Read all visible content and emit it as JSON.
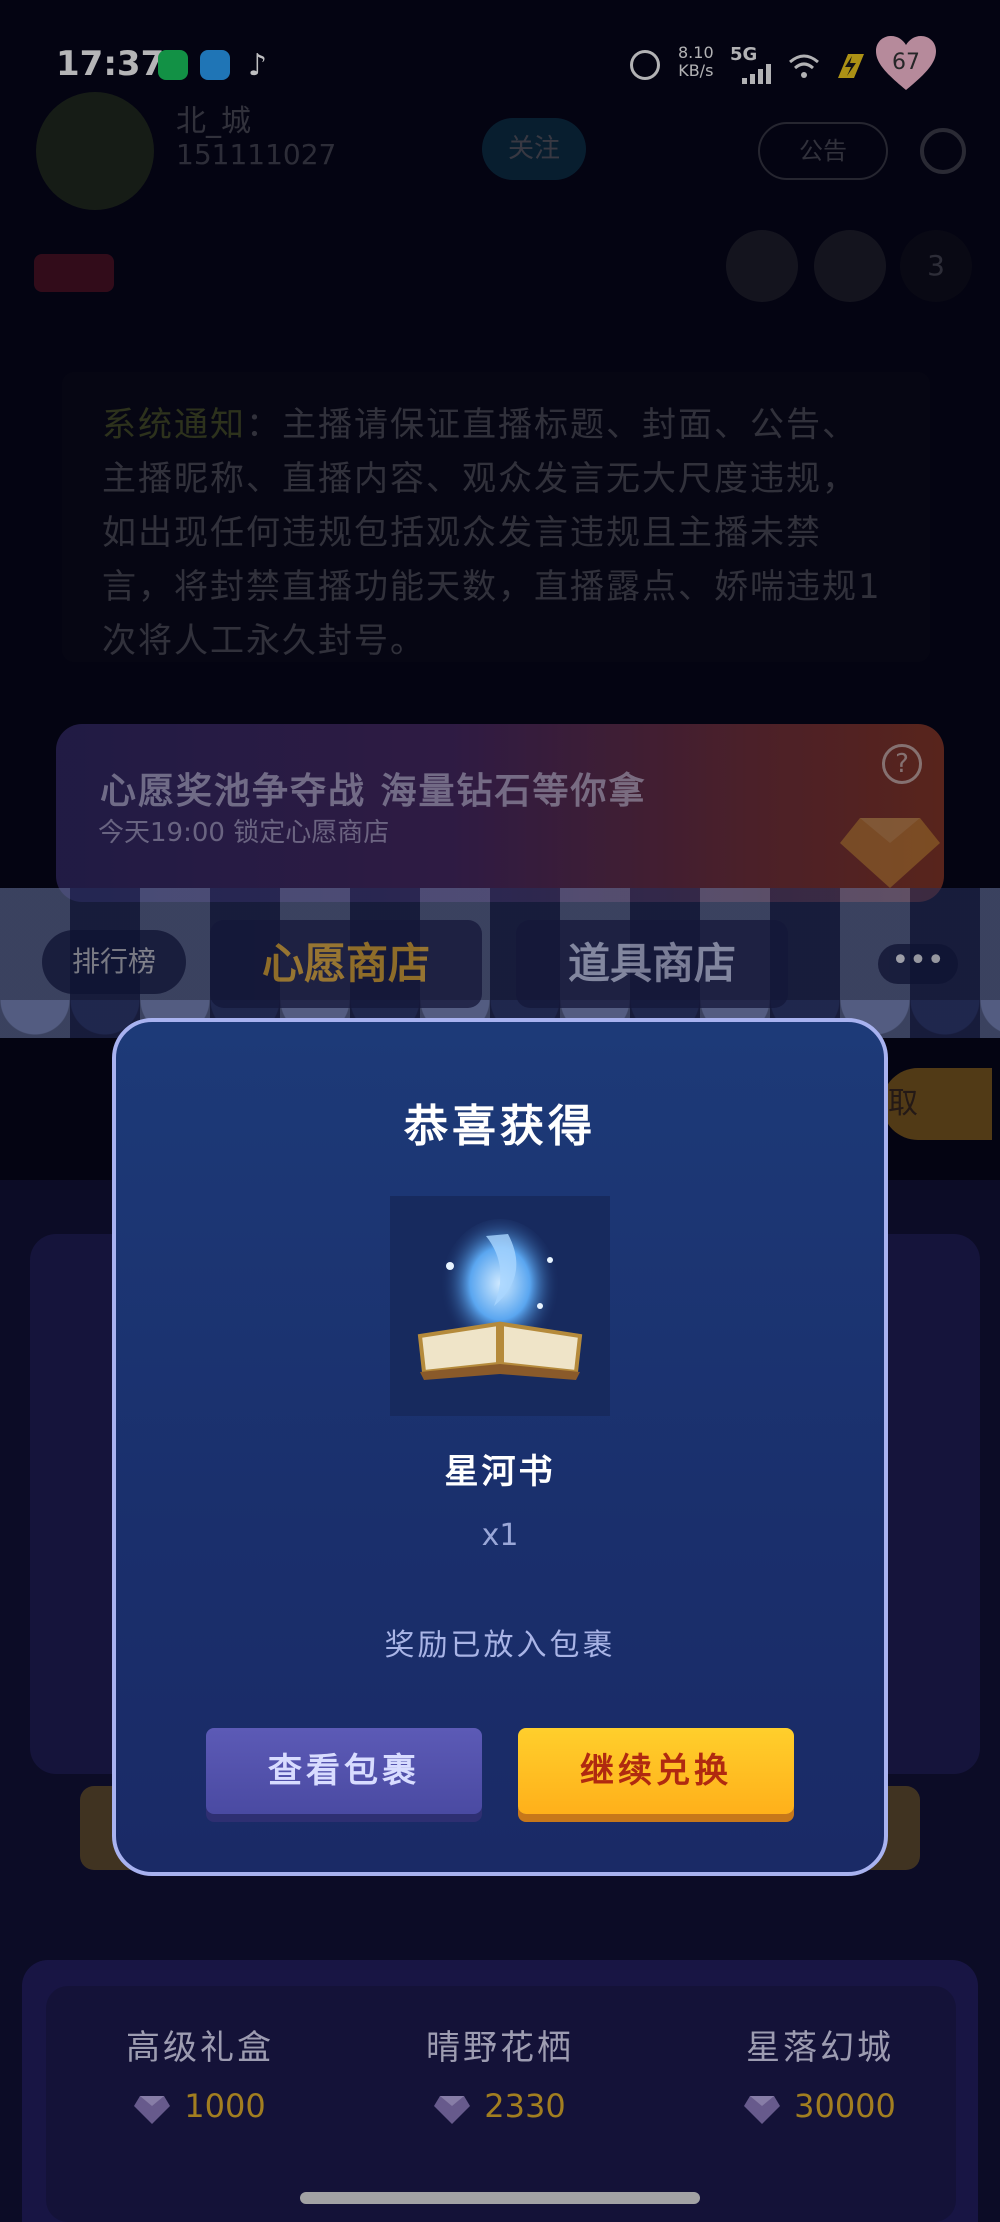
{
  "status_bar": {
    "time": "17:37",
    "net_speed": "8.10",
    "net_unit": "KB/s",
    "network": "5G",
    "battery": "67"
  },
  "background": {
    "streamer_name": "北_城",
    "streamer_id": "151111027",
    "follow_label": "关注",
    "notice_label": "公告",
    "guest_count": "3",
    "system_notice_prefix": "系统通知",
    "system_notice_text": "：主播请保证直播标题、封面、公告、主播昵称、直播内容、观众发言无大尺度违规，如出现任何违规包括观众发言违规且主播未禁言，将封禁直播功能天数，直播露点、娇喘违规1次将人工永久封号。",
    "banner_title": "心愿奖池争夺战 海量钻石等你拿",
    "banner_subtitle": "今天19:00 锁定心愿商店",
    "tabs": {
      "rank": "排行榜",
      "wish_shop": "心愿商店",
      "item_shop": "道具商店",
      "more": "•••"
    },
    "side_button": "取",
    "products": [
      {
        "name": "高级礼盒",
        "price": "1000"
      },
      {
        "name": "晴野花栖",
        "price": "2330"
      },
      {
        "name": "星落幻城",
        "price": "30000"
      }
    ]
  },
  "modal": {
    "title": "恭喜获得",
    "gift_name": "星河书",
    "gift_qty": "x1",
    "tip": "奖励已放入包裹",
    "view_button": "查看包裹",
    "continue_button": "继续兑换"
  },
  "colors": {
    "modal_bg": "#1a2f6c",
    "modal_border": "#a8b2f0",
    "continue_button": "#ffb01a",
    "view_button": "#4a4aa2",
    "price": "#d9a928"
  }
}
